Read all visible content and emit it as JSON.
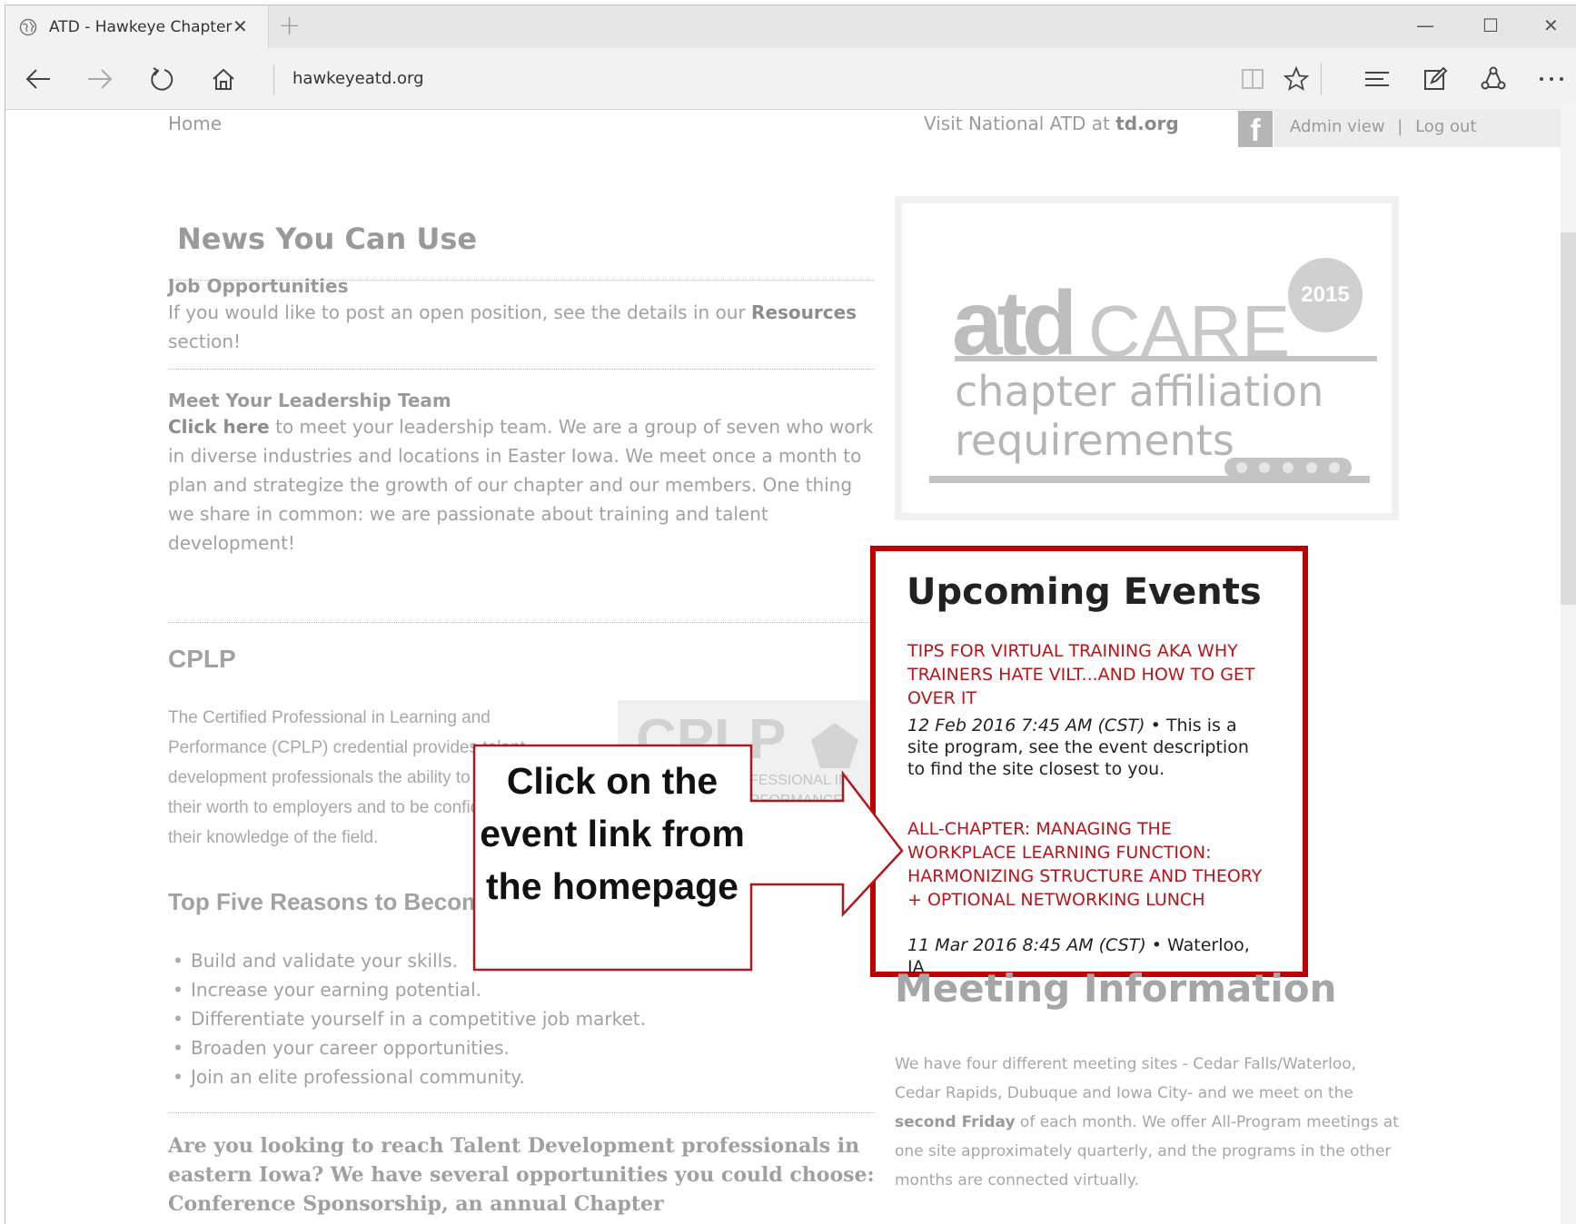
{
  "browser": {
    "tab_title": "ATD - Hawkeye Chapter",
    "tab_close": "✕",
    "new_tab": "+",
    "address": "hawkeyeatd.org",
    "window_controls": [
      "—",
      "☐",
      "✕"
    ]
  },
  "header": {
    "home": "Home",
    "visit_prefix": "Visit National ATD at ",
    "visit_link": "td.org",
    "facebook": "f",
    "admin_view": "Admin view",
    "separator": "|",
    "log_out": "Log out"
  },
  "news": {
    "title": "News You Can Use",
    "job_heading": "Job Opportunities",
    "job_text_before": "If you would like to post an open position, see the details in our ",
    "job_link": "Resources",
    "job_text_after": " section!",
    "leader_heading": "Meet Your Leadership Team",
    "leader_link": "Click here",
    "leader_text": " to meet your leadership team. We are a group of seven who work in diverse industries and locations in Easter Iowa. We meet once a month to plan and strategize the growth of our chapter and our members. One thing we share in common: we are passionate about training and talent development!"
  },
  "cplp": {
    "title": "CPLP",
    "text": "The Certified Professional in Learning and Performance (CPLP) credential provides talent development professionals the ability to prove their worth to employers and to be confident in their knowledge of the field.",
    "logo_big": "CPLP",
    "logo_line1": "FESSIONAL IN",
    "logo_line2": "RFORMANCE"
  },
  "top5": {
    "title": "Top Five Reasons to Become CPLP",
    "items": [
      "Build and validate your skills.",
      "Increase your earning potential.",
      "Differentiate yourself in a competitive job market.",
      "Broaden your career opportunities.",
      "Join an elite professional community."
    ]
  },
  "bottom": {
    "text": "Are you looking to reach Talent Development professionals in eastern Iowa? We have several opportunities you could choose: Conference Sponsorship, an annual Chapter"
  },
  "ad": {
    "atd": "atd",
    "care": "CARE",
    "line1": "chapter affiliation",
    "line2": "requirements",
    "year": "2015"
  },
  "events": {
    "title": "Upcoming Events",
    "items": [
      {
        "title": "TIPS FOR VIRTUAL TRAINING AKA WHY TRAINERS HATE VILT...AND HOW TO GET OVER IT",
        "date": "12 Feb 2016 7:45 AM (CST)",
        "detail": " • This is a site program, see the event description to find the site closest to you."
      },
      {
        "title": "ALL-CHAPTER: MANAGING THE WORKPLACE LEARNING FUNCTION: HARMONIZING STRUCTURE AND THEORY + OPTIONAL NETWORKING LUNCH",
        "date": "11 Mar 2016 8:45 AM (CST)",
        "detail": " • Waterloo, IA"
      }
    ]
  },
  "meeting": {
    "title": "Meeting Information",
    "text_before": "We have four different meeting sites - Cedar Falls/Waterloo, Cedar Rapids, Dubuque and Iowa City- and we meet on the ",
    "bold": "second Friday",
    "text_after": " of each month. We offer All-Program meetings at one site approximately quarterly, and the programs in the other months are connected virtually."
  },
  "callout": {
    "text": "Click on the event link from the homepage"
  },
  "colors": {
    "highlight_border": "#c00000",
    "event_link": "#b5161b"
  }
}
